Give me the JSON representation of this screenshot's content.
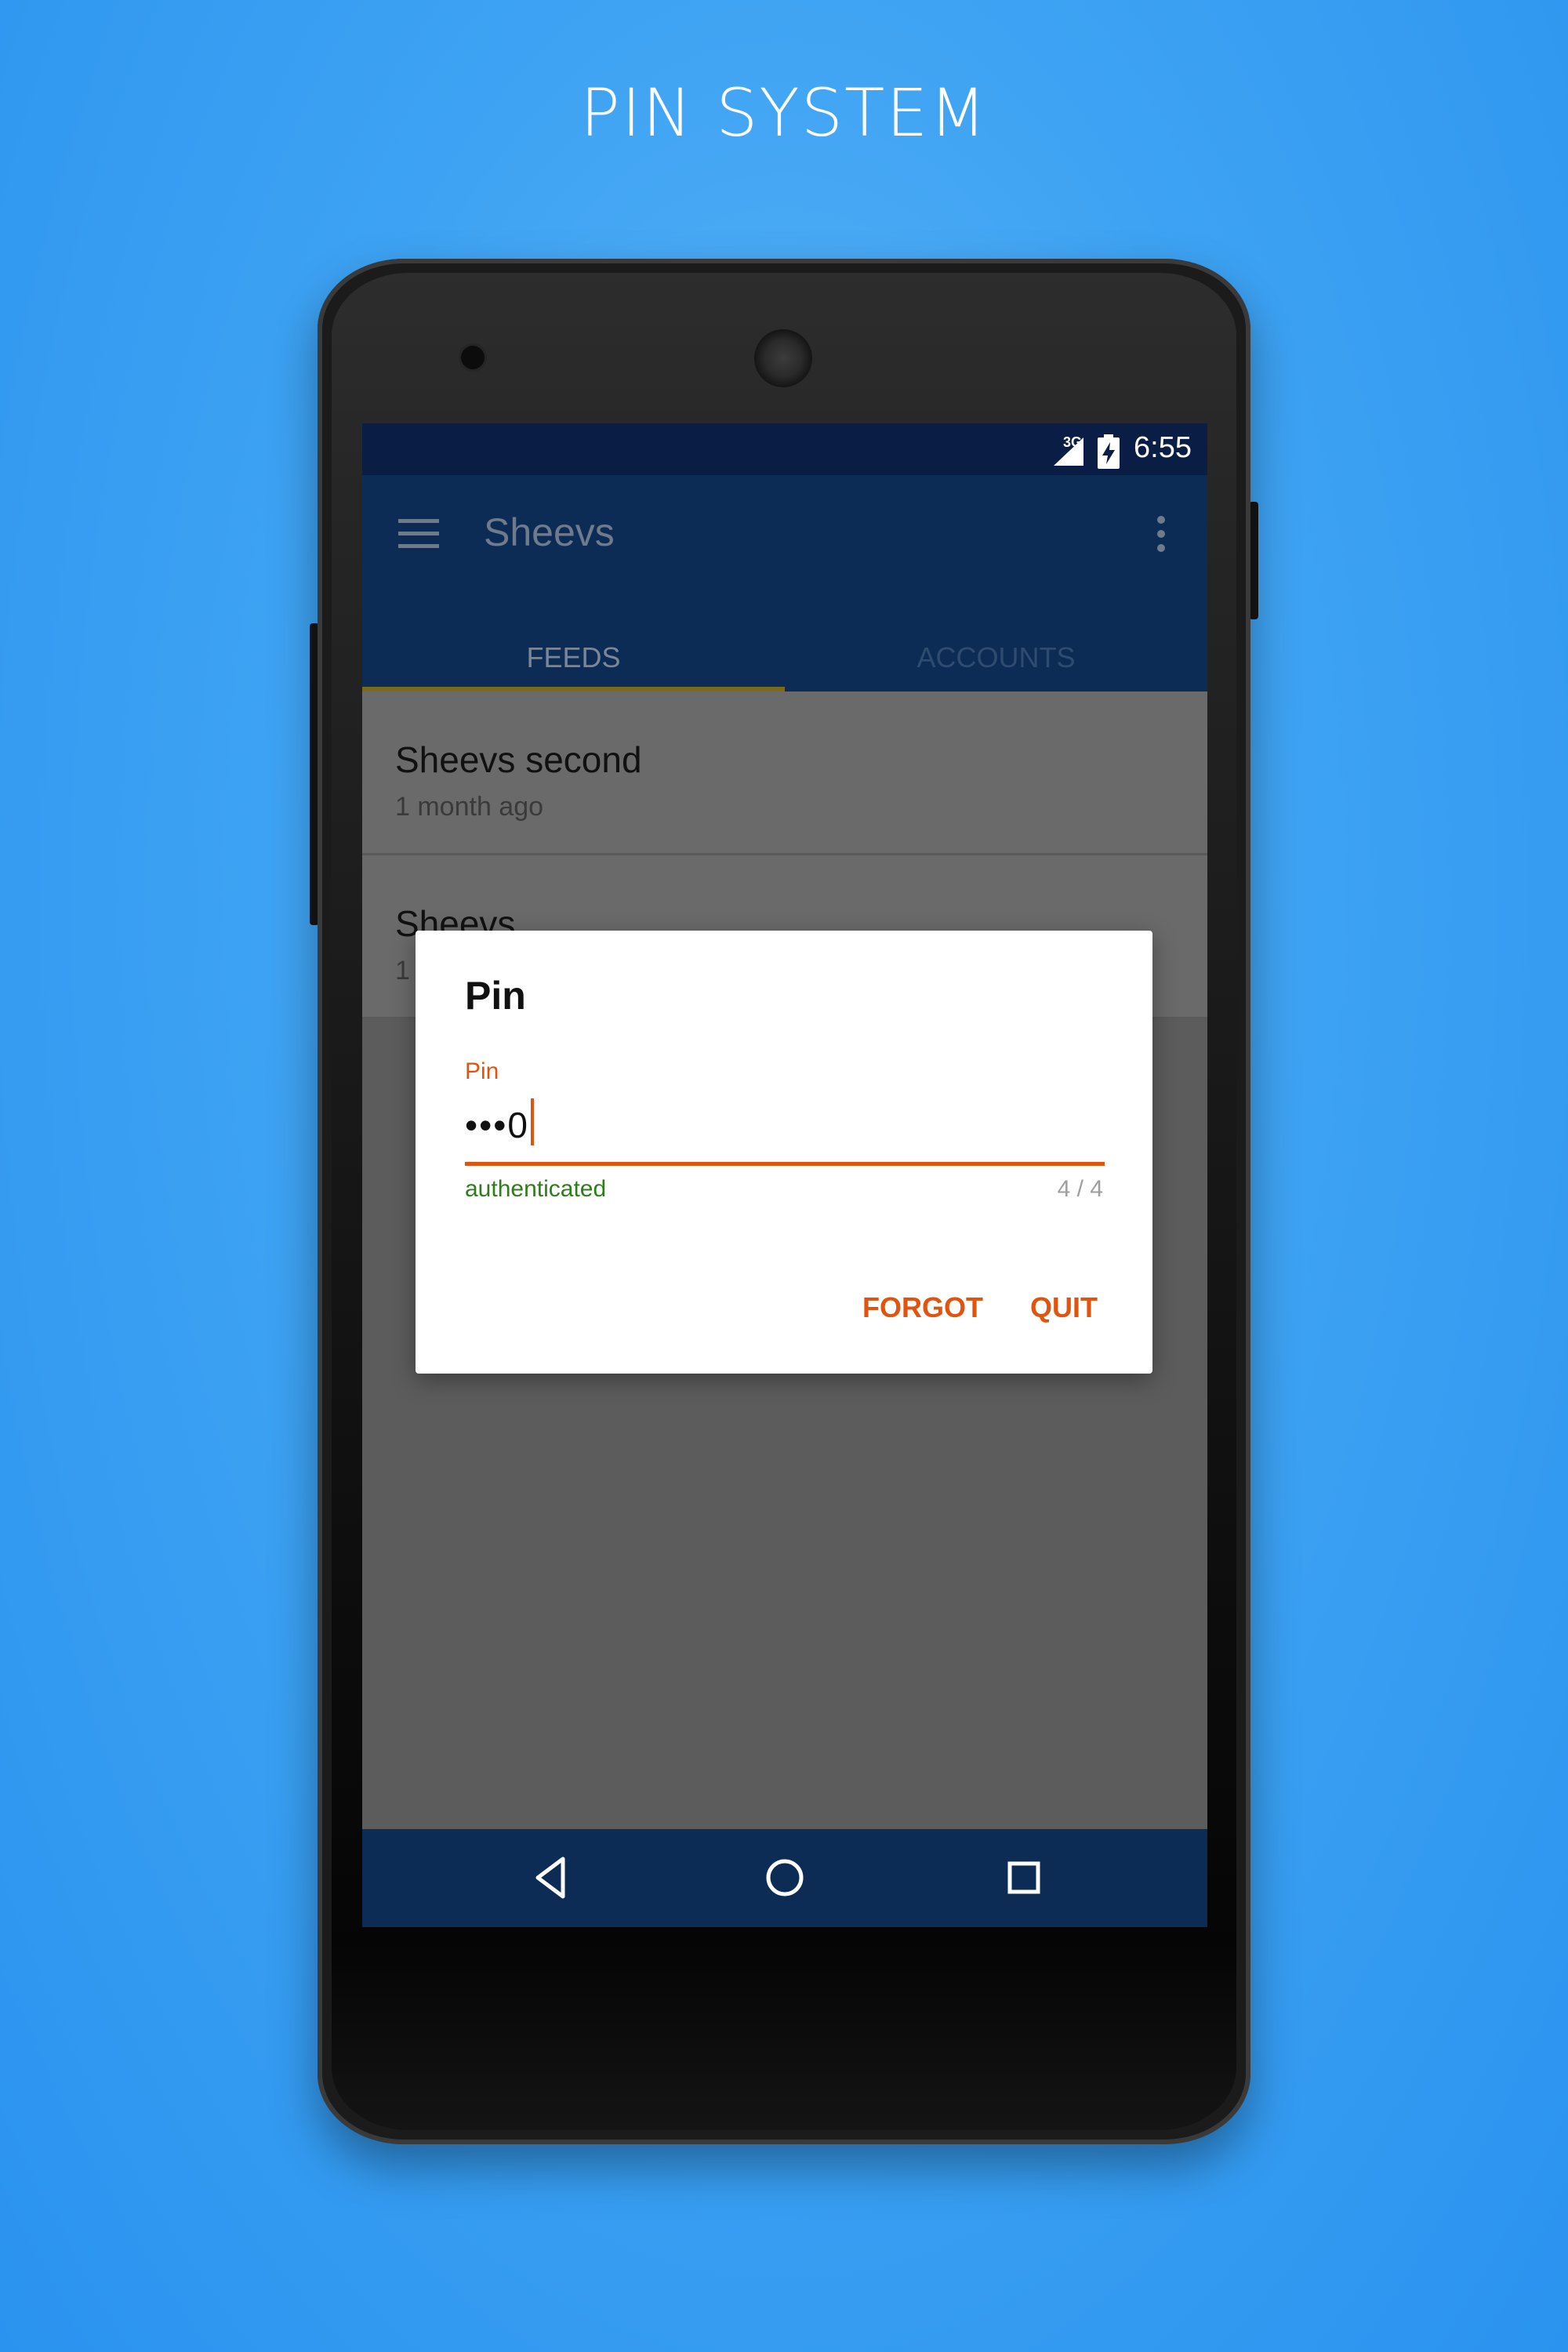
{
  "headline": "PIN SYSTEM",
  "status_bar": {
    "network": "3G",
    "time": "6:55"
  },
  "app_bar": {
    "title": "Sheevs"
  },
  "tabs": [
    {
      "label": "FEEDS",
      "selected": true
    },
    {
      "label": "ACCOUNTS",
      "selected": false
    }
  ],
  "feed_items": [
    {
      "title": "Sheevs second",
      "subtitle": "1 month ago"
    },
    {
      "title": "Sheevs",
      "subtitle": "1"
    }
  ],
  "dialog": {
    "title": "Pin",
    "field_label": "Pin",
    "field_value": "•••0",
    "helper": "authenticated",
    "counter": "4 / 4",
    "buttons": {
      "forgot": "FORGOT",
      "quit": "QUIT"
    }
  },
  "nav_icons": [
    "back-icon",
    "home-icon",
    "recents-icon"
  ],
  "colors": {
    "accent": "#e0540f",
    "app_bar": "#0c2b55",
    "status_bar": "#0a1d45",
    "success": "#2e7d1b",
    "background": "#3ea3f3"
  }
}
